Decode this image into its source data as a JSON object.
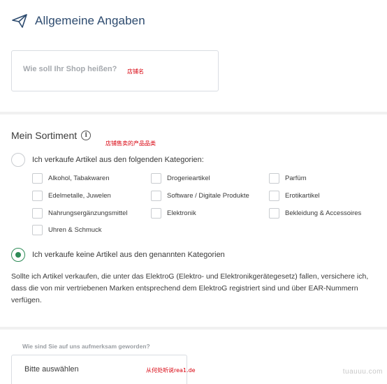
{
  "general": {
    "title": "Allgemeine Angaben",
    "shop_name_placeholder": "Wie soll Ihr Shop heißen?",
    "annotation": "店铺名"
  },
  "assortment": {
    "title": "Mein Sortiment",
    "info_icon": "i",
    "annotation": "店铺售卖的产品品类",
    "option_sells": "Ich verkaufe Artikel aus den folgenden Kategorien:",
    "option_none": "Ich verkaufe keine Artikel aus den genannten Kategorien",
    "selected_option": "none",
    "categories": [
      "Alkohol, Tabakwaren",
      "Drogerieartikel",
      "Parfüm",
      "Edelmetalle, Juwelen",
      "Software / Digitale Produkte",
      "Erotikartikel",
      "Nahrungsergänzungsmittel",
      "Elektronik",
      "Bekleidung & Accessoires",
      "Uhren & Schmuck"
    ],
    "notice": "Sollte ich Artikel verkaufen, die unter das ElektroG (Elektro- und Elektronikgerätegesetz) fallen, versichere ich, dass die von mir vertriebenen Marken entsprechend dem ElektroG registriert sind und über EAR-Nummern verfügen."
  },
  "source": {
    "label": "Wie sind Sie auf uns aufmerksam geworden?",
    "select_value": "Bitte auswählen",
    "annotation": "从何处听说rea1.de"
  },
  "watermark": "tuauuu.com",
  "colors": {
    "accent_blue": "#2c4a6e",
    "radio_green": "#2e8b57",
    "annotation_red": "#d8000c"
  },
  "icons": {
    "header": "paper-plane-icon",
    "info": "info-icon"
  }
}
